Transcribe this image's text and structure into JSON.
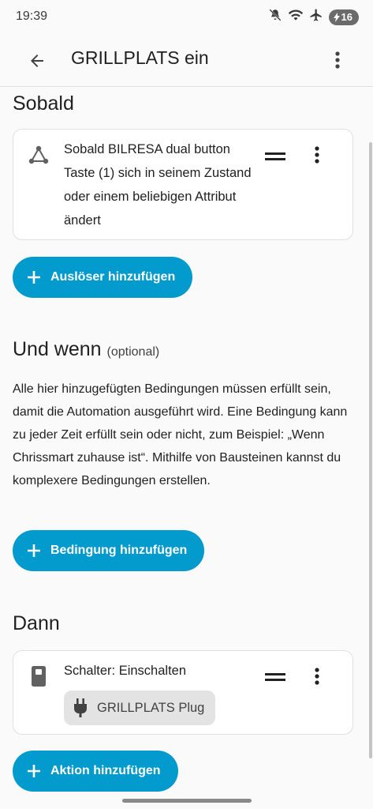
{
  "status": {
    "time": "19:39",
    "battery": "16",
    "icons": [
      "mute-icon",
      "wifi-icon",
      "airplane-icon",
      "battery-icon"
    ]
  },
  "appbar": {
    "title": "GRILLPLATS ein",
    "back_icon": "arrow-left-icon",
    "more_icon": "more-vert-icon"
  },
  "trigger": {
    "heading": "Sobald",
    "card_text": "Sobald BILRESA dual button Taste (1) sich in seinem Zustand oder einem beliebigen Attribut ändert",
    "icon": "state-change-icon",
    "add_label": "Auslöser hinzufügen"
  },
  "condition": {
    "heading": "Und wenn",
    "optional": "(optional)",
    "description": "Alle hier hinzugefügten Bedingungen müssen erfüllt sein, damit die Automation ausgeführt wird. Eine Bedingung kann zu jeder Zeit erfüllt sein oder nicht, zum Beispiel: „Wenn Chrissmart zuhause ist“. Mithilfe von Bausteinen kannst du komplexere Bedingungen erstellen.",
    "add_label": "Bedingung hinzufügen"
  },
  "action": {
    "heading": "Dann",
    "card_title": "Schalter: Einschalten",
    "chip_label": "GRILLPLATS Plug",
    "icon": "switch-icon",
    "chip_icon": "plug-icon",
    "add_label": "Aktion hinzufügen"
  },
  "colors": {
    "accent": "#039bce",
    "background": "#fafafa",
    "card": "#ffffff",
    "chip": "#e3e3e3"
  }
}
